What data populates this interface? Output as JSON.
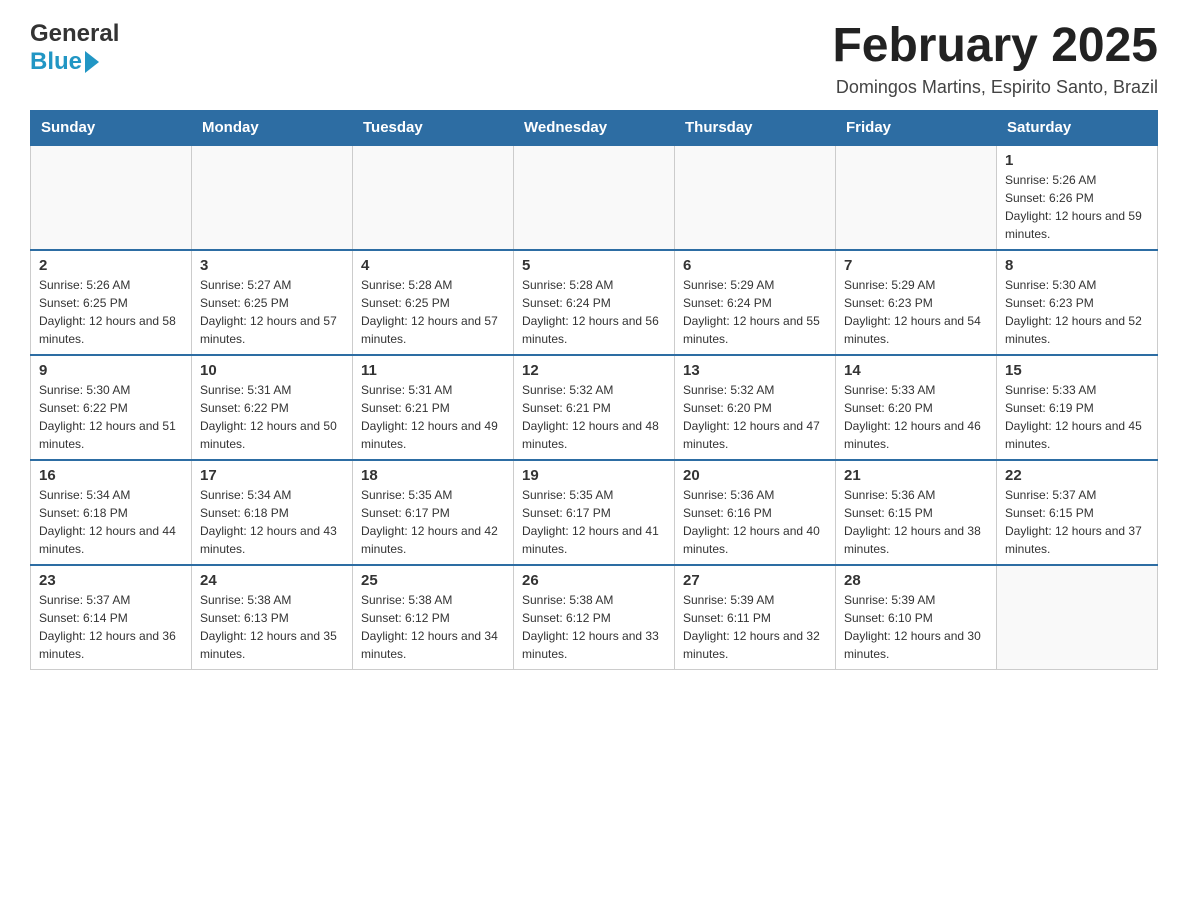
{
  "header": {
    "logo_general": "General",
    "logo_blue": "Blue",
    "month_title": "February 2025",
    "subtitle": "Domingos Martins, Espirito Santo, Brazil"
  },
  "days_of_week": [
    "Sunday",
    "Monday",
    "Tuesday",
    "Wednesday",
    "Thursday",
    "Friday",
    "Saturday"
  ],
  "weeks": [
    [
      {
        "day": "",
        "info": ""
      },
      {
        "day": "",
        "info": ""
      },
      {
        "day": "",
        "info": ""
      },
      {
        "day": "",
        "info": ""
      },
      {
        "day": "",
        "info": ""
      },
      {
        "day": "",
        "info": ""
      },
      {
        "day": "1",
        "info": "Sunrise: 5:26 AM\nSunset: 6:26 PM\nDaylight: 12 hours and 59 minutes."
      }
    ],
    [
      {
        "day": "2",
        "info": "Sunrise: 5:26 AM\nSunset: 6:25 PM\nDaylight: 12 hours and 58 minutes."
      },
      {
        "day": "3",
        "info": "Sunrise: 5:27 AM\nSunset: 6:25 PM\nDaylight: 12 hours and 57 minutes."
      },
      {
        "day": "4",
        "info": "Sunrise: 5:28 AM\nSunset: 6:25 PM\nDaylight: 12 hours and 57 minutes."
      },
      {
        "day": "5",
        "info": "Sunrise: 5:28 AM\nSunset: 6:24 PM\nDaylight: 12 hours and 56 minutes."
      },
      {
        "day": "6",
        "info": "Sunrise: 5:29 AM\nSunset: 6:24 PM\nDaylight: 12 hours and 55 minutes."
      },
      {
        "day": "7",
        "info": "Sunrise: 5:29 AM\nSunset: 6:23 PM\nDaylight: 12 hours and 54 minutes."
      },
      {
        "day": "8",
        "info": "Sunrise: 5:30 AM\nSunset: 6:23 PM\nDaylight: 12 hours and 52 minutes."
      }
    ],
    [
      {
        "day": "9",
        "info": "Sunrise: 5:30 AM\nSunset: 6:22 PM\nDaylight: 12 hours and 51 minutes."
      },
      {
        "day": "10",
        "info": "Sunrise: 5:31 AM\nSunset: 6:22 PM\nDaylight: 12 hours and 50 minutes."
      },
      {
        "day": "11",
        "info": "Sunrise: 5:31 AM\nSunset: 6:21 PM\nDaylight: 12 hours and 49 minutes."
      },
      {
        "day": "12",
        "info": "Sunrise: 5:32 AM\nSunset: 6:21 PM\nDaylight: 12 hours and 48 minutes."
      },
      {
        "day": "13",
        "info": "Sunrise: 5:32 AM\nSunset: 6:20 PM\nDaylight: 12 hours and 47 minutes."
      },
      {
        "day": "14",
        "info": "Sunrise: 5:33 AM\nSunset: 6:20 PM\nDaylight: 12 hours and 46 minutes."
      },
      {
        "day": "15",
        "info": "Sunrise: 5:33 AM\nSunset: 6:19 PM\nDaylight: 12 hours and 45 minutes."
      }
    ],
    [
      {
        "day": "16",
        "info": "Sunrise: 5:34 AM\nSunset: 6:18 PM\nDaylight: 12 hours and 44 minutes."
      },
      {
        "day": "17",
        "info": "Sunrise: 5:34 AM\nSunset: 6:18 PM\nDaylight: 12 hours and 43 minutes."
      },
      {
        "day": "18",
        "info": "Sunrise: 5:35 AM\nSunset: 6:17 PM\nDaylight: 12 hours and 42 minutes."
      },
      {
        "day": "19",
        "info": "Sunrise: 5:35 AM\nSunset: 6:17 PM\nDaylight: 12 hours and 41 minutes."
      },
      {
        "day": "20",
        "info": "Sunrise: 5:36 AM\nSunset: 6:16 PM\nDaylight: 12 hours and 40 minutes."
      },
      {
        "day": "21",
        "info": "Sunrise: 5:36 AM\nSunset: 6:15 PM\nDaylight: 12 hours and 38 minutes."
      },
      {
        "day": "22",
        "info": "Sunrise: 5:37 AM\nSunset: 6:15 PM\nDaylight: 12 hours and 37 minutes."
      }
    ],
    [
      {
        "day": "23",
        "info": "Sunrise: 5:37 AM\nSunset: 6:14 PM\nDaylight: 12 hours and 36 minutes."
      },
      {
        "day": "24",
        "info": "Sunrise: 5:38 AM\nSunset: 6:13 PM\nDaylight: 12 hours and 35 minutes."
      },
      {
        "day": "25",
        "info": "Sunrise: 5:38 AM\nSunset: 6:12 PM\nDaylight: 12 hours and 34 minutes."
      },
      {
        "day": "26",
        "info": "Sunrise: 5:38 AM\nSunset: 6:12 PM\nDaylight: 12 hours and 33 minutes."
      },
      {
        "day": "27",
        "info": "Sunrise: 5:39 AM\nSunset: 6:11 PM\nDaylight: 12 hours and 32 minutes."
      },
      {
        "day": "28",
        "info": "Sunrise: 5:39 AM\nSunset: 6:10 PM\nDaylight: 12 hours and 30 minutes."
      },
      {
        "day": "",
        "info": ""
      }
    ]
  ]
}
